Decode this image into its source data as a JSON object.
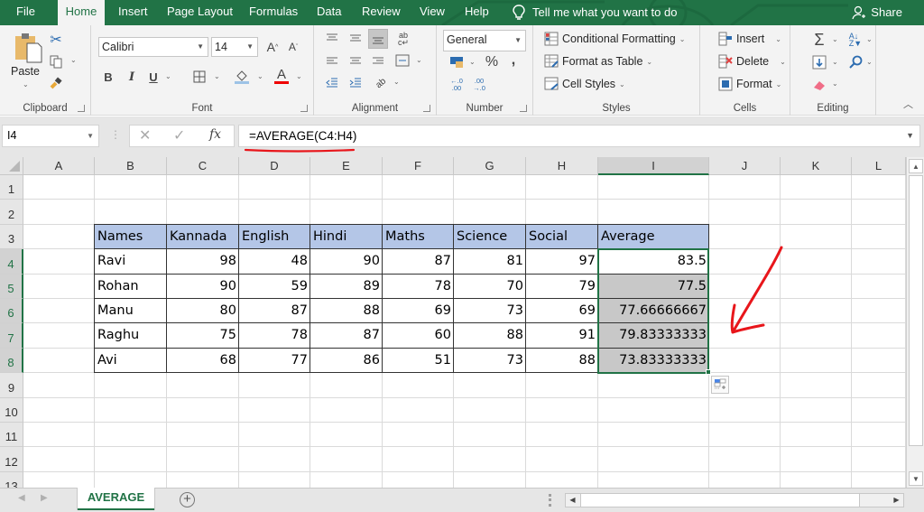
{
  "ribbon_tabs": [
    "File",
    "Home",
    "Insert",
    "Page Layout",
    "Formulas",
    "Data",
    "Review",
    "View",
    "Help"
  ],
  "active_tab": "Home",
  "tell_me": "Tell me what you want to do",
  "share_label": "Share",
  "groups": {
    "clipboard": {
      "label": "Clipboard",
      "paste": "Paste"
    },
    "font": {
      "label": "Font",
      "font_name": "Calibri",
      "font_size": "14",
      "bold": "B",
      "italic": "I",
      "underline": "U",
      "font_color_letter": "A",
      "grow": "A",
      "shrink": "A"
    },
    "alignment": {
      "label": "Alignment"
    },
    "number": {
      "label": "Number",
      "format": "General",
      "percent": "%",
      "comma": ",",
      "inc_decimal": "←.0 .00",
      "dec_decimal": ".00 →.0"
    },
    "styles": {
      "label": "Styles",
      "conditional": "Conditional Formatting",
      "format_table": "Format as Table",
      "cell_styles": "Cell Styles"
    },
    "cells": {
      "label": "Cells",
      "insert": "Insert",
      "delete": "Delete",
      "format": "Format"
    },
    "editing": {
      "label": "Editing",
      "sum": "Σ"
    }
  },
  "formula_bar": {
    "name_box": "I4",
    "cancel": "✕",
    "enter": "✓",
    "fx": "fx",
    "formula": "=AVERAGE(C4:H4)"
  },
  "columns": [
    "A",
    "B",
    "C",
    "D",
    "E",
    "F",
    "G",
    "H",
    "I",
    "J",
    "K",
    "L"
  ],
  "selected_column": "I",
  "rows": [
    "1",
    "2",
    "3",
    "4",
    "5",
    "6",
    "7",
    "8",
    "9",
    "10",
    "11",
    "12",
    "13"
  ],
  "table": {
    "headers": [
      "Names",
      "Kannada",
      "English",
      "Hindi",
      "Maths",
      "Science",
      "Social",
      "Average"
    ],
    "records": [
      [
        "Ravi",
        "98",
        "48",
        "90",
        "87",
        "81",
        "97",
        "83.5"
      ],
      [
        "Rohan",
        "90",
        "59",
        "89",
        "78",
        "70",
        "79",
        "77.5"
      ],
      [
        "Manu",
        "80",
        "87",
        "88",
        "69",
        "73",
        "69",
        "77.66666667"
      ],
      [
        "Raghu",
        "75",
        "78",
        "87",
        "60",
        "88",
        "91",
        "79.83333333"
      ],
      [
        "Avi",
        "68",
        "77",
        "86",
        "51",
        "73",
        "88",
        "73.83333333"
      ]
    ]
  },
  "colors": {
    "excel_green": "#217346",
    "header_fill": "#b4c6e7",
    "selection_fill": "#c8c8c8",
    "annotation_red": "#e8161b"
  },
  "sheets": [
    {
      "name": "AVERAGE",
      "active": true
    }
  ],
  "add_sheet": "+"
}
